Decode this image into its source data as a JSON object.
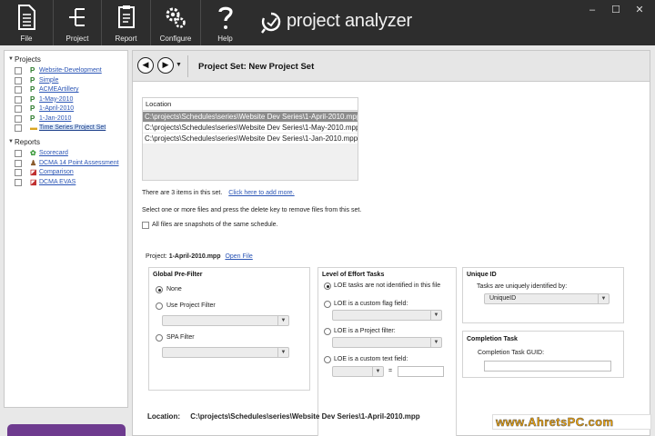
{
  "toolbar": {
    "buttons": [
      {
        "label": "File",
        "icon": "file-icon"
      },
      {
        "label": "Project",
        "icon": "project-icon"
      },
      {
        "label": "Report",
        "icon": "report-icon"
      },
      {
        "label": "Configure",
        "icon": "gears-icon"
      },
      {
        "label": "Help",
        "icon": "help-icon"
      }
    ],
    "brand": "project analyzer",
    "window_controls": [
      "–",
      "☐",
      "✕"
    ]
  },
  "sidebar": {
    "projects_label": "Projects",
    "projects": [
      "Website-Development",
      "Simple",
      "ACMEArtillery",
      "1-May-2010",
      "1-April-2010",
      "1-Jan-2010",
      "Time Series Project Set"
    ],
    "reports_label": "Reports",
    "reports": [
      "Scorecard",
      "DCMA 14 Point Assessment",
      "Comparison",
      "DCMA EVAS"
    ]
  },
  "nav": {
    "title": "Project Set: New Project Set"
  },
  "files": {
    "header": "Location",
    "rows": [
      "C:\\projects\\Schedules\\series\\Website Dev Series\\1-April-2010.mpp",
      "C:\\projects\\Schedules\\series\\Website Dev Series\\1-May-2010.mpp",
      "C:\\projects\\Schedules\\series\\Website Dev Series\\1-Jan-2010.mpp"
    ],
    "count_text": "There are 3 items in this set.",
    "add_link": "Click here to add more.",
    "instruction": "Select one or more files and press the delete key to remove files from this set.",
    "snapshot_label": "All files are snapshots of the same schedule."
  },
  "project": {
    "label": "Project:",
    "name": "1-April-2010.mpp",
    "open_link": "Open File"
  },
  "global_filter": {
    "title": "Global Pre-Filter",
    "none": "None",
    "use_project": "Use Project Filter",
    "spa": "SPA Filter"
  },
  "loe": {
    "title": "Level of Effort Tasks",
    "opt1": "LOE tasks are not identified in this file",
    "opt2": "LOE is a custom flag field:",
    "opt3": "LOE is a Project filter:",
    "opt4": "LOE is a custom text field:",
    "equals": "="
  },
  "unique": {
    "title": "Unique ID",
    "label": "Tasks are uniquely identified by:",
    "value": "UniqueID"
  },
  "completion": {
    "title": "Completion Task",
    "label": "Completion Task GUID:"
  },
  "location_footer": {
    "label": "Location:",
    "value": "C:\\projects\\Schedules\\series\\Website Dev Series\\1-April-2010.mpp"
  },
  "watermark": "www.AhretsPC.com",
  "colors": {
    "toolbar_bg": "#2d2d2d",
    "link": "#2b55b5",
    "selected_row": "#8c8c8c",
    "sidebar_button": "#6e3b8f"
  }
}
